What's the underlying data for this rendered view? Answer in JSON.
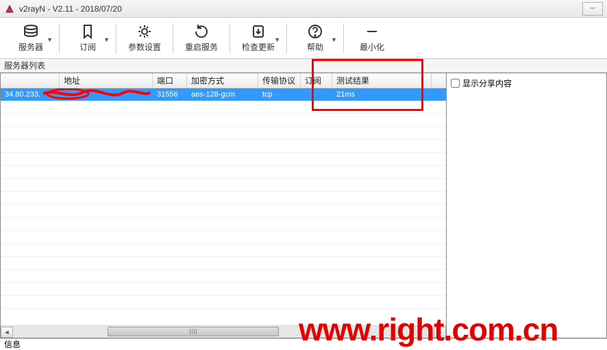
{
  "window": {
    "title": "v2rayN - V2.11 - 2018/07/20"
  },
  "toolbar": {
    "servers": "服务器",
    "subscribe": "订阅",
    "settings": "参数设置",
    "restart": "重启服务",
    "update": "检查更新",
    "help": "帮助",
    "minimize": "最小化"
  },
  "labels": {
    "server_list": "服务器列表",
    "show_share": "显示分享内容",
    "info": "信息"
  },
  "table": {
    "headers": {
      "addr": "地址",
      "port": "端口",
      "enc": "加密方式",
      "proto": "传输协议",
      "sub": "订阅",
      "result": "测试结果"
    },
    "rows": [
      {
        "ip_prefix": "34.80.233.",
        "addr_redacted": true,
        "port": "31556",
        "enc": "aes-128-gcm",
        "proto": "tcp",
        "sub": "",
        "result": "21ms"
      }
    ]
  },
  "watermark": "www.right.com.cn"
}
